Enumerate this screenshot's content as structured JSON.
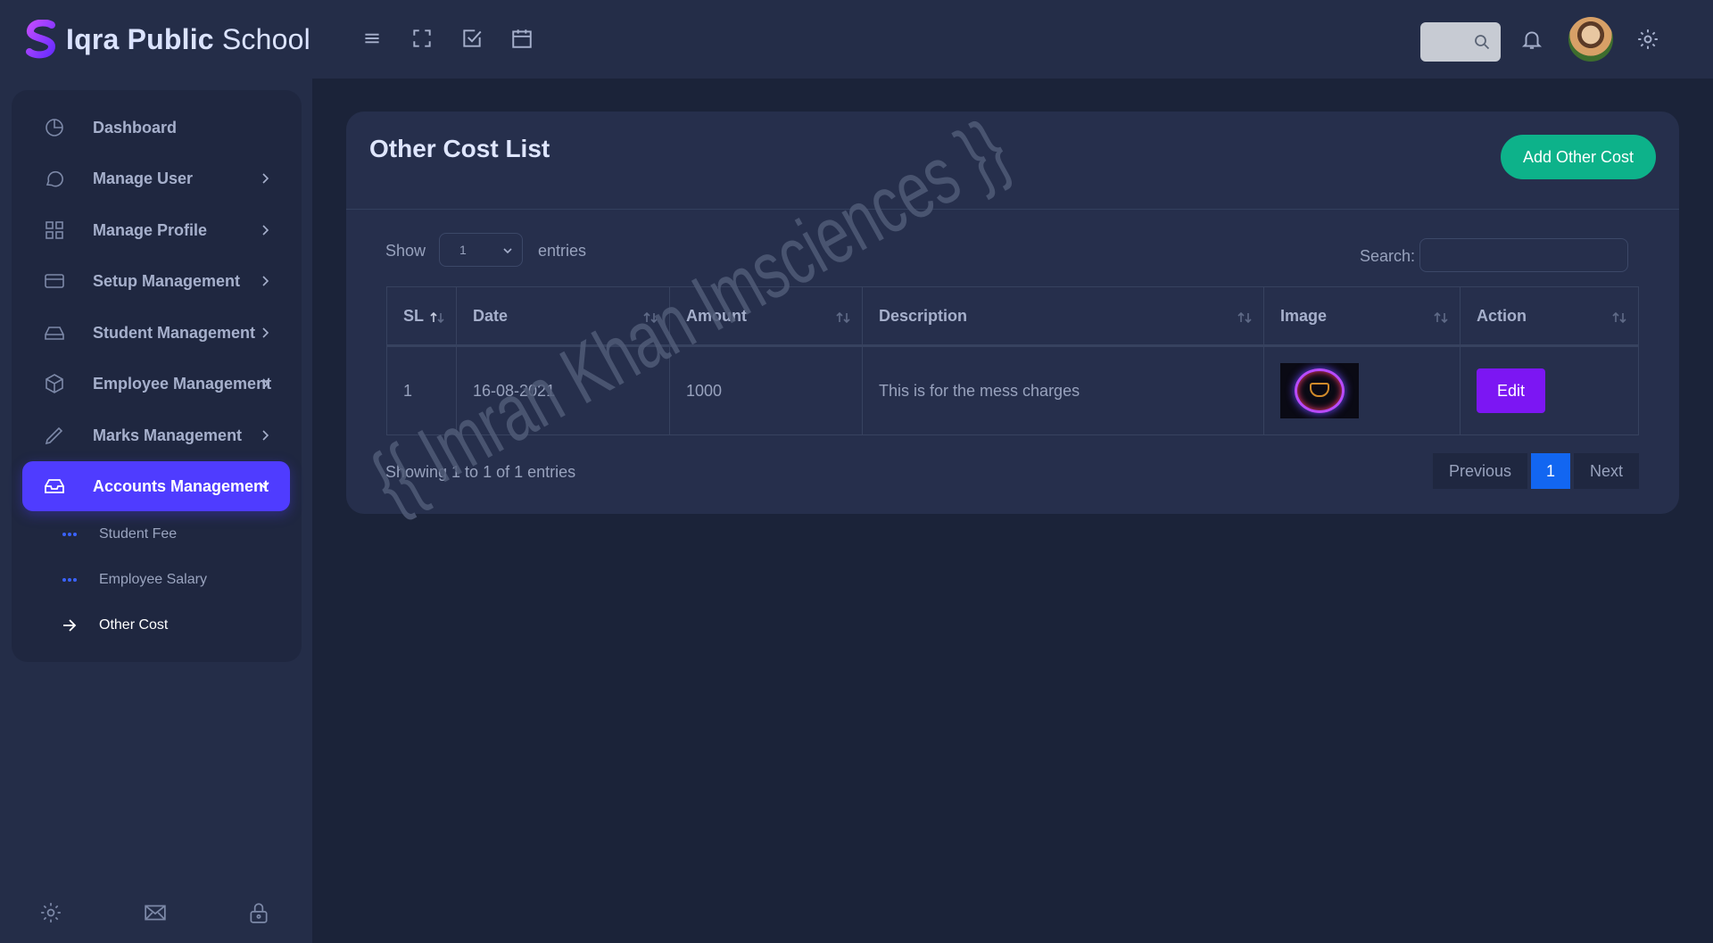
{
  "brand": {
    "name_bold": "Iqra Public",
    "name_light": "School"
  },
  "sidebar": {
    "items": [
      {
        "label": "Dashboard",
        "icon": "pie-chart-icon"
      },
      {
        "label": "Manage User",
        "icon": "chat-icon"
      },
      {
        "label": "Manage Profile",
        "icon": "grid-icon"
      },
      {
        "label": "Setup Management",
        "icon": "credit-card-icon"
      },
      {
        "label": "Student Management",
        "icon": "hard-drive-icon"
      },
      {
        "label": "Employee Management",
        "icon": "box-icon"
      },
      {
        "label": "Marks Management",
        "icon": "pencil-icon"
      },
      {
        "label": "Accounts Management",
        "icon": "inbox-icon"
      }
    ],
    "sub_items": [
      {
        "label": "Student Fee"
      },
      {
        "label": "Employee Salary"
      },
      {
        "label": "Other Cost"
      }
    ]
  },
  "card": {
    "title": "Other Cost List",
    "add_label": "Add Other Cost",
    "show_label": "Show",
    "entries_value": "1",
    "entries_label": "entries",
    "search_label": "Search:"
  },
  "table": {
    "headers": [
      "SL",
      "Date",
      "Amount",
      "Description",
      "Image",
      "Action"
    ],
    "rows": [
      {
        "sl": "1",
        "date": "16-08-2021",
        "amount": "1000",
        "description": "This is for the mess charges",
        "action": "Edit"
      }
    ]
  },
  "footer": {
    "info": "Showing 1 to 1 of 1 entries",
    "prev": "Previous",
    "page": "1",
    "next": "Next"
  },
  "watermark": "{{ Imran Khan Imsciences }}",
  "colors": {
    "accent": "#4f3cff",
    "success": "#0db28a",
    "edit": "#7c16f3",
    "page_active": "#1266f1"
  }
}
